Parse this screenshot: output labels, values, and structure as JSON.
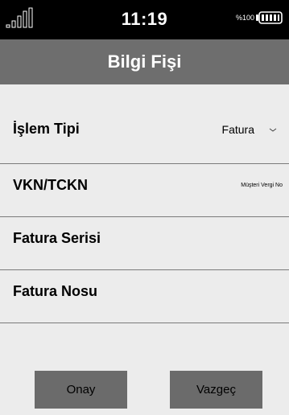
{
  "status_bar": {
    "signal_icon": "signal-bars-icon",
    "time": "11:19",
    "battery_percent": "%100",
    "battery_icon": "battery-full-icon"
  },
  "header": {
    "title": "Bilgi Fişi"
  },
  "form": {
    "fields": [
      {
        "label": "İşlem Tipi",
        "value": "Fatura",
        "icon": "chevron-down-icon"
      },
      {
        "label": "VKN/TCKN",
        "hint": "Müşteri Vergi No"
      },
      {
        "label": "Fatura Serisi"
      },
      {
        "label": "Fatura Nosu"
      }
    ]
  },
  "actions": {
    "confirm_label": "Onay",
    "cancel_label": "Vazgeç"
  },
  "colors": {
    "status_bar": "#000000",
    "header": "#6e6e6e",
    "background": "#ececec",
    "button": "#6b6b6b"
  }
}
